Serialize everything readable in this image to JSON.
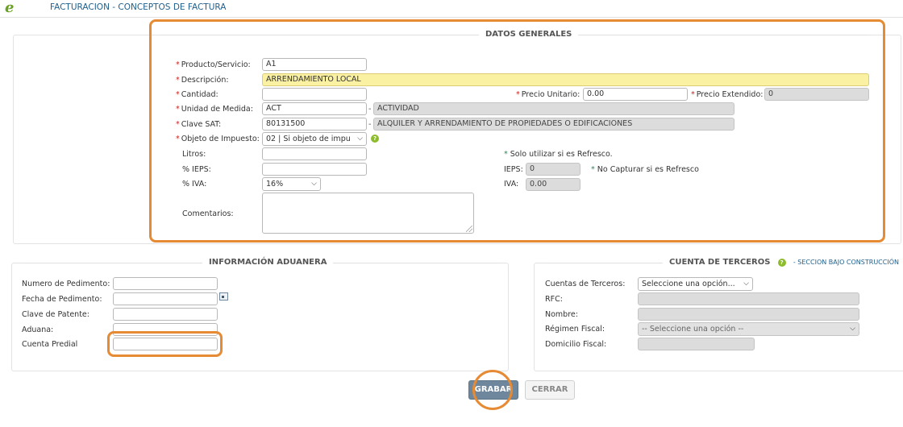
{
  "header": {
    "logo": "e",
    "title": "FACTURACION - CONCEPTOS DE FACTURA"
  },
  "datos_generales": {
    "title": "DATOS GENERALES",
    "producto_label": "Producto/Servicio:",
    "producto_value": "A1",
    "descripcion_label": "Descripción:",
    "descripcion_value": "ARRENDAMIENTO LOCAL",
    "cantidad_label": "Cantidad:",
    "cantidad_value": "",
    "precio_unitario_label": "Precio Unitario:",
    "precio_unitario_value": "0.00",
    "precio_extendido_label": "Precio Extendido:",
    "precio_extendido_value": "0",
    "unidad_label": "Unidad de Medida:",
    "unidad_value": "ACT",
    "unidad_desc": "ACTIVIDAD",
    "clave_sat_label": "Clave SAT:",
    "clave_sat_value": "80131500",
    "clave_sat_desc": "ALQUILER Y ARRENDAMIENTO DE PROPIEDADES O EDIFICACIONES",
    "objeto_label": "Objeto de Impuesto:",
    "objeto_value": "02 | Si objeto de impu",
    "litros_label": "Litros:",
    "litros_value": "",
    "ieps_pct_label": "% IEPS:",
    "ieps_pct_value": "",
    "iva_pct_label": "% IVA:",
    "iva_pct_value": "16%",
    "refresco_note": "Solo utilizar si es Refresco.",
    "ieps_label": "IEPS:",
    "ieps_value": "0",
    "no_capturar_note": "No Capturar si es Refresco",
    "iva_label": "IVA:",
    "iva_value": "0.00",
    "comentarios_label": "Comentarios:",
    "comentarios_value": ""
  },
  "aduanera": {
    "title": "INFORMACIÓN ADUANERA",
    "pedimento_label": "Numero de Pedimento:",
    "fecha_label": "Fecha de Pedimento:",
    "patente_label": "Clave de Patente:",
    "aduana_label": "Aduana:",
    "predial_label": "Cuenta Predial"
  },
  "terceros": {
    "title": "CUENTA DE TERCEROS",
    "under_construction": "- SECCION BAJO CONSTRUCCIÓN",
    "cuentas_label": "Cuentas de Terceros:",
    "cuentas_value": "Seleccione una opción...",
    "rfc_label": "RFC:",
    "nombre_label": "Nombre:",
    "regimen_label": "Régimen Fiscal:",
    "regimen_value": "-- Seleccione una opción --",
    "domicilio_label": "Domicilio Fiscal:"
  },
  "buttons": {
    "grabar": "GRABAR",
    "cerrar": "CERRAR"
  },
  "colors": {
    "highlight": "#e68a33",
    "title_blue": "#1f5f8b",
    "required": "#cc2222"
  }
}
